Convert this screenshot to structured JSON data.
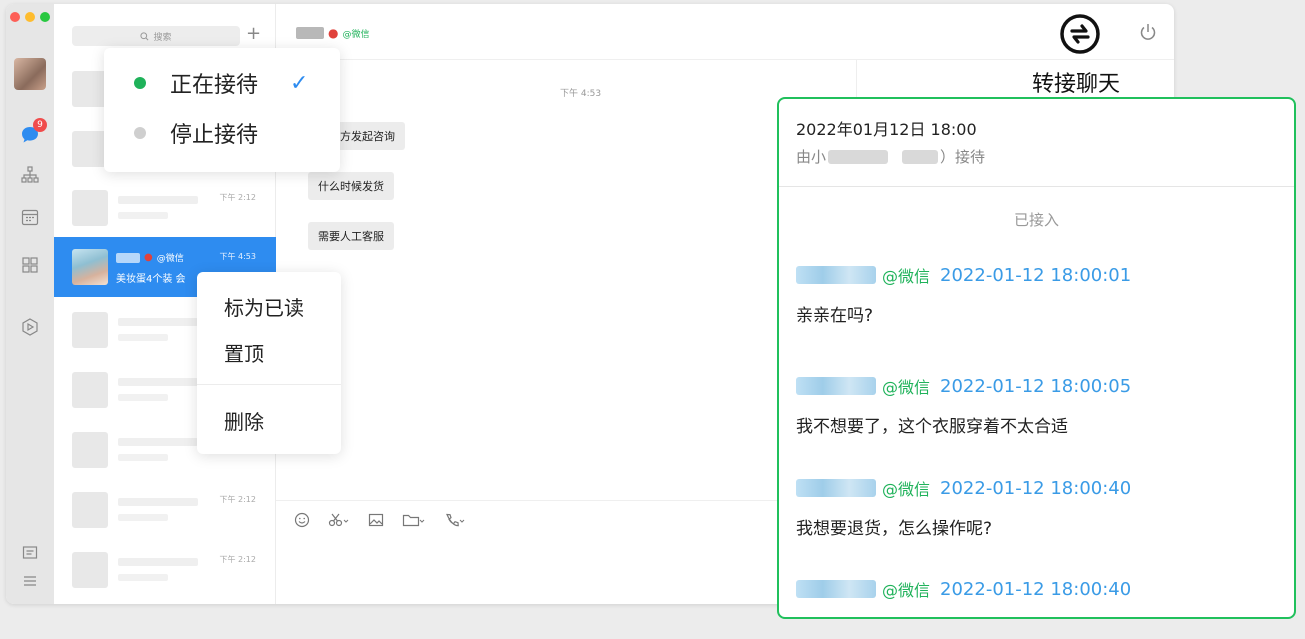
{
  "search": {
    "placeholder": "搜索"
  },
  "rail": {
    "unread_badge": "9"
  },
  "list": {
    "times": [
      "下午 2:12",
      "下午 2:12",
      "下午 2:12",
      "下午 2:12"
    ],
    "active": {
      "tag": "@微信",
      "time": "下午 4:53",
      "preview": "美妆蛋4个装 会"
    }
  },
  "chat": {
    "header_tag": "@微信",
    "system_time": "下午 4:53",
    "messages": [
      "信官方发起咨询",
      "什么时候发货",
      "需要人工客服"
    ],
    "transfer_label": "转接聊天"
  },
  "status_menu": {
    "items": [
      {
        "label": "正在接待",
        "color": "#1fb25a",
        "checked": true
      },
      {
        "label": "停止接待",
        "color": "#cfcfcf",
        "checked": false
      }
    ],
    "check_mark": "✓"
  },
  "context_menu": {
    "items": [
      "标为已读",
      "置顶",
      "删除"
    ]
  },
  "record": {
    "date": "2022年01月12日 18:00",
    "by_prefix": "由小",
    "by_suffix": "）接待",
    "status": "已接入",
    "messages": [
      {
        "tag": "@微信",
        "time": "2022-01-12 18:00:01",
        "text": "亲亲在吗?"
      },
      {
        "tag": "@微信",
        "time": "2022-01-12 18:00:05",
        "text": "我不想要了，这个衣服穿着不太合适"
      },
      {
        "tag": "@微信",
        "time": "2022-01-12 18:00:40",
        "text": "我想要退货，怎么操作呢?"
      },
      {
        "tag": "@微信",
        "time": "2022-01-12 18:00:40",
        "text": ""
      }
    ]
  },
  "colors": {
    "accent_blue": "#2e8cf0",
    "accent_green": "#20c05c"
  }
}
